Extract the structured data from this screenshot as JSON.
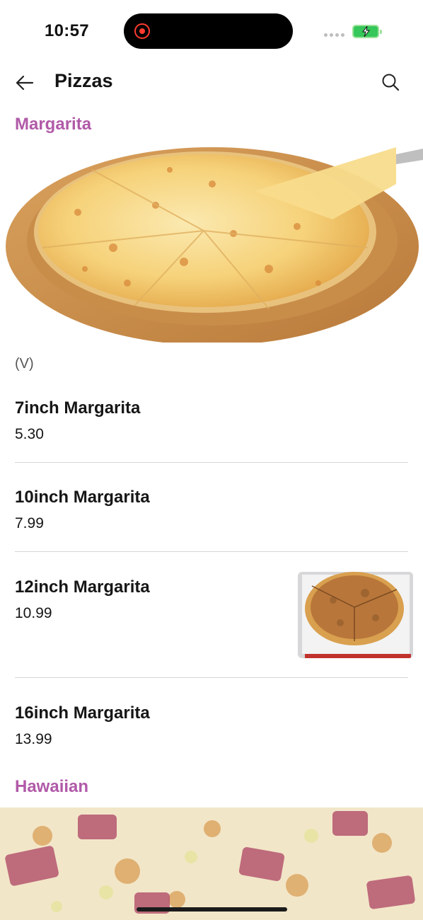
{
  "status": {
    "time": "10:57"
  },
  "header": {
    "title": "Pizzas"
  },
  "sections": [
    {
      "title": "Margarita",
      "tag": "(V)",
      "items": [
        {
          "name": "7inch Margarita",
          "price": "5.30"
        },
        {
          "name": "10inch Margarita",
          "price": "7.99"
        },
        {
          "name": "12inch Margarita",
          "price": "10.99"
        },
        {
          "name": "16inch Margarita",
          "price": "13.99"
        }
      ]
    },
    {
      "title": "Hawaiian"
    }
  ],
  "colors": {
    "accent": "#b15aa8",
    "divider": "#d6d6d6",
    "battery": "#35c759",
    "record": "#ff3b30"
  },
  "icons": [
    "back-arrow-icon",
    "search-icon",
    "record-icon",
    "battery-charging-icon"
  ]
}
